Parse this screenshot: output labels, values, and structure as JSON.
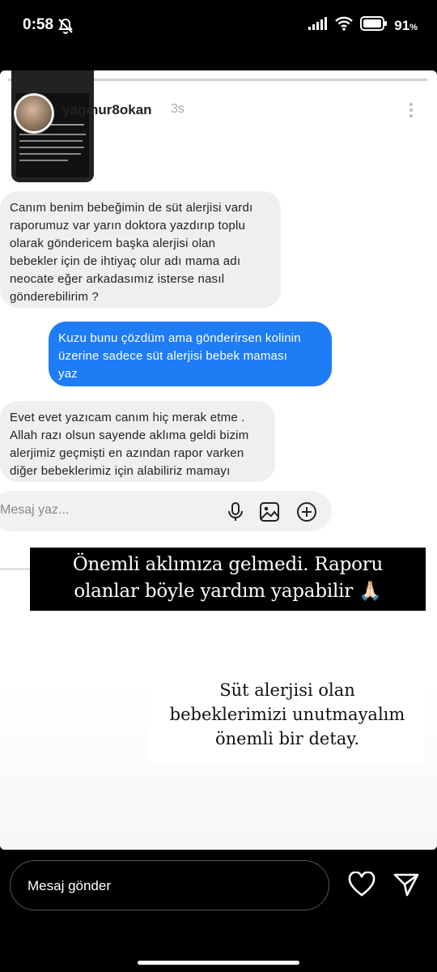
{
  "status_bar": {
    "time": "0:58",
    "battery": "91",
    "battery_unit": "%"
  },
  "story": {
    "username": "yagmur8okan",
    "time_ago": "3s",
    "thumbnail_lines": [
      "Bebeğine gelen yoruma özel erkke mama lazım",
      "Antalya'da sezaryen yavaş yavaşla ekonomisi",
      "Antalya'daki yardıma ihtiyacı olan"
    ]
  },
  "chat": {
    "messages": [
      {
        "side": "left",
        "lines": [
          "Canım benim bebeğimin de süt alerjisi vardı",
          "raporumuz var yarın doktora yazdırıp toplu",
          "olarak göndericem başka alerjisi olan",
          "bebekler için  de ihtiyaç olur adı  mama adı",
          "neocate eğer arkadasımız isterse nasıl",
          "gönderebilirim  ?"
        ]
      },
      {
        "side": "right",
        "lines": [
          "Kuzu bunu çözdüm ama gönderirsen kolinin",
          "üzerine sadece süt alerjisi bebek maması",
          "yaz"
        ]
      },
      {
        "side": "left",
        "lines": [
          "Evet evet yazıcam canım hiç merak etme .",
          "Allah razı olsun sayende aklıma geldi bizim",
          "alerjimiz geçmişti en azından rapor varken",
          "diğer bebeklerimiz için alabiliriz mamayı"
        ]
      }
    ],
    "compose_placeholder": "Mesaj yaz..."
  },
  "captions": {
    "caption1": [
      "Önemli aklımıza gelmedi. Raporu",
      "olanlar böyle yardım yapabilir 🙏🏻"
    ],
    "caption2": [
      "Süt alerjisi olan",
      "bebeklerimizi unutmayalım",
      "önemli bir detay."
    ]
  },
  "reply_bar": {
    "placeholder": "Mesaj gönder"
  },
  "colors": {
    "accent_blue": "#1e7cf5",
    "bubble_grey": "#efefef"
  }
}
